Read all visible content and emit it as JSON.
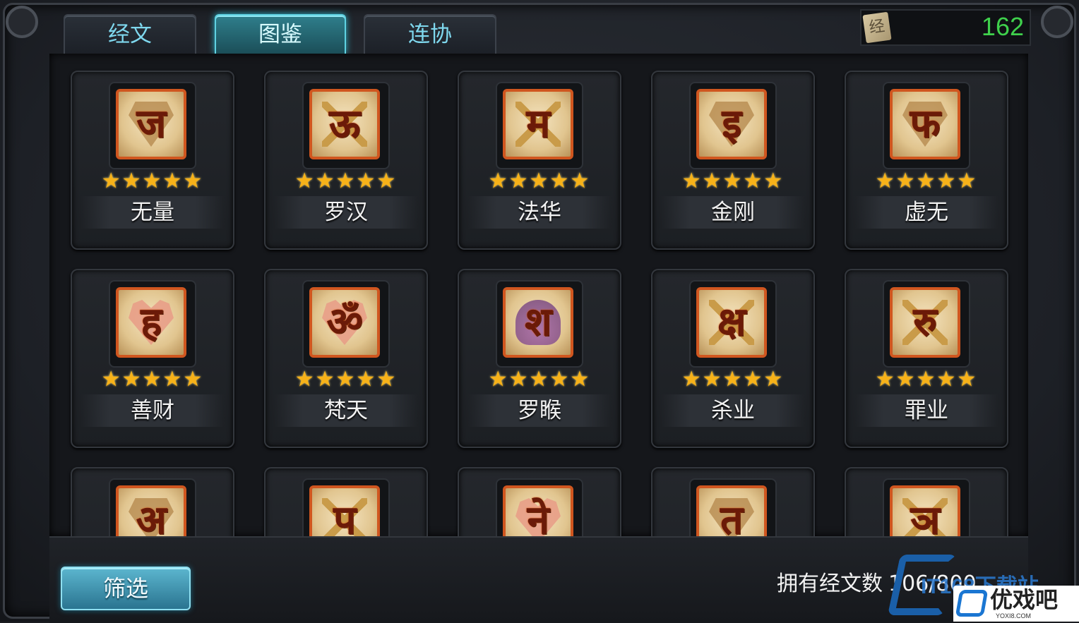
{
  "tabs": [
    {
      "label": "经文",
      "active": false
    },
    {
      "label": "图鉴",
      "active": true
    },
    {
      "label": "连协",
      "active": false
    }
  ],
  "currency": {
    "icon": "scroll-icon",
    "value": "162"
  },
  "cards": [
    {
      "name": "无量",
      "stars": 5,
      "glyph": "ज",
      "emblem": "shield"
    },
    {
      "name": "罗汉",
      "stars": 5,
      "glyph": "ऊ",
      "emblem": "cross"
    },
    {
      "name": "法华",
      "stars": 5,
      "glyph": "म",
      "emblem": "cross"
    },
    {
      "name": "金刚",
      "stars": 5,
      "glyph": "इ",
      "emblem": "shield"
    },
    {
      "name": "虚无",
      "stars": 5,
      "glyph": "फ",
      "emblem": "shield"
    },
    {
      "name": "善财",
      "stars": 5,
      "glyph": "ह",
      "emblem": "heart"
    },
    {
      "name": "梵天",
      "stars": 5,
      "glyph": "ॐ",
      "emblem": "heart"
    },
    {
      "name": "罗睺",
      "stars": 5,
      "glyph": "श",
      "emblem": "flame"
    },
    {
      "name": "杀业",
      "stars": 5,
      "glyph": "क्ष",
      "emblem": "cross"
    },
    {
      "name": "罪业",
      "stars": 5,
      "glyph": "रु",
      "emblem": "cross"
    },
    {
      "name": "",
      "stars": 0,
      "glyph": "अ",
      "emblem": "shield"
    },
    {
      "name": "",
      "stars": 0,
      "glyph": "प",
      "emblem": "cross"
    },
    {
      "name": "",
      "stars": 0,
      "glyph": "ने",
      "emblem": "heart"
    },
    {
      "name": "",
      "stars": 0,
      "glyph": "त",
      "emblem": "shield"
    },
    {
      "name": "",
      "stars": 0,
      "glyph": "ञ",
      "emblem": "cross"
    }
  ],
  "footer": {
    "filter_label": "筛选",
    "owned_label": "拥有经文数",
    "owned_count": "106/800"
  },
  "watermark": {
    "site_text": "IT168下载站",
    "badge_text": "优戏吧",
    "badge_url": "YOXI8.COM"
  },
  "colors": {
    "accent_cyan": "#5fd2e2",
    "currency_green": "#3fd14c",
    "star_gold": "#f7b219",
    "tile_border": "#d0561f"
  }
}
